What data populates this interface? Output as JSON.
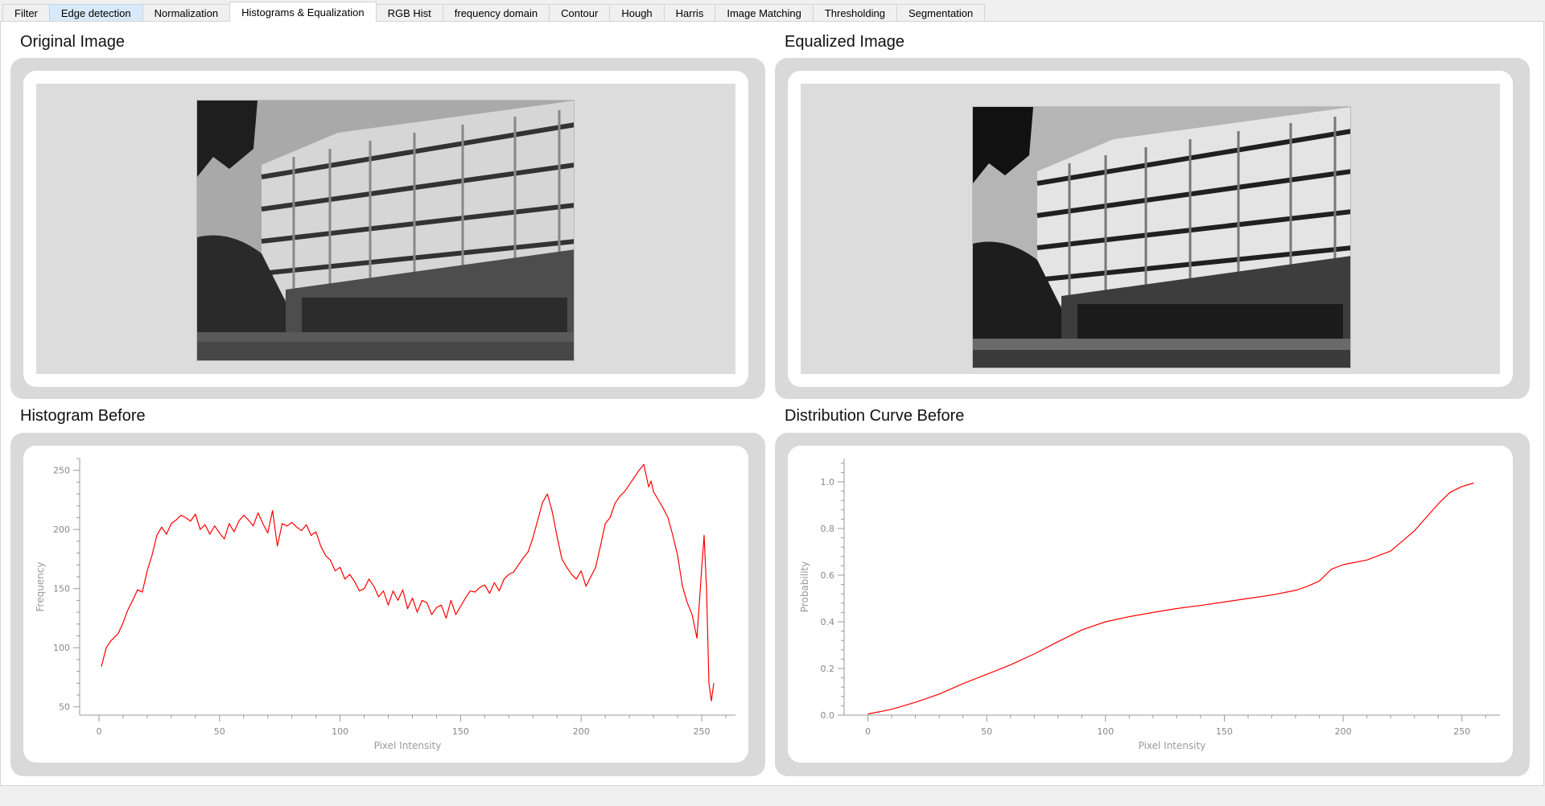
{
  "tabs": [
    {
      "label": "Filter",
      "state": "normal"
    },
    {
      "label": "Edge detection",
      "state": "hover"
    },
    {
      "label": "Normalization",
      "state": "normal"
    },
    {
      "label": "Histograms & Equalization",
      "state": "active"
    },
    {
      "label": "RGB Hist",
      "state": "normal"
    },
    {
      "label": "frequency domain",
      "state": "normal"
    },
    {
      "label": "Contour",
      "state": "normal"
    },
    {
      "label": "Hough",
      "state": "normal"
    },
    {
      "label": "Harris",
      "state": "normal"
    },
    {
      "label": "Image Matching",
      "state": "normal"
    },
    {
      "label": "Thresholding",
      "state": "normal"
    },
    {
      "label": "Segmentation",
      "state": "normal"
    }
  ],
  "panels": {
    "original_title": "Original Image",
    "equalized_title": "Equalized Image",
    "histogram_title": "Histogram Before",
    "distribution_title": "Distribution Curve Before"
  },
  "colors": {
    "curve": "#ff0000",
    "panel_bg": "#d9d9d9",
    "axis": "#999999"
  },
  "chart_data": [
    {
      "type": "line",
      "title": "",
      "xlabel": "Pixel Intensity",
      "ylabel": "Frequency",
      "xlim": [
        -8,
        264
      ],
      "ylim": [
        43,
        260
      ],
      "xticks": [
        0,
        50,
        100,
        150,
        200,
        250
      ],
      "yticks": [
        50,
        100,
        150,
        200,
        250
      ],
      "series": [
        {
          "x": [
            1,
            3,
            5,
            8,
            10,
            12,
            14,
            16,
            18,
            20,
            22,
            24,
            26,
            28,
            30,
            32,
            34,
            36,
            38,
            40,
            42,
            44,
            46,
            48,
            50,
            52,
            54,
            56,
            58,
            60,
            62,
            64,
            66,
            68,
            70,
            72,
            74,
            76,
            78,
            80,
            82,
            84,
            86,
            88,
            90,
            92,
            94,
            96,
            98,
            100,
            102,
            104,
            106,
            108,
            110,
            112,
            114,
            116,
            118,
            120,
            122,
            124,
            126,
            128,
            130,
            132,
            134,
            136,
            138,
            140,
            142,
            144,
            146,
            148,
            150,
            152,
            154,
            156,
            158,
            160,
            162,
            164,
            166,
            168,
            170,
            172,
            174,
            176,
            178,
            180,
            182,
            184,
            186,
            188,
            190,
            192,
            194,
            196,
            198,
            200,
            202,
            204,
            206,
            208,
            210,
            212,
            214,
            216,
            218,
            220,
            222,
            224,
            226,
            228,
            229,
            230,
            232,
            234,
            236,
            238,
            240,
            242,
            244,
            246,
            248,
            250,
            251,
            252,
            253,
            254,
            255
          ],
          "values": [
            84,
            100,
            106,
            112,
            121,
            132,
            140,
            149,
            147,
            165,
            178,
            195,
            202,
            196,
            205,
            208,
            212,
            210,
            207,
            213,
            200,
            204,
            196,
            203,
            197,
            192,
            205,
            198,
            207,
            212,
            208,
            203,
            214,
            205,
            197,
            216,
            186,
            205,
            203,
            206,
            202,
            199,
            204,
            195,
            198,
            186,
            178,
            174,
            165,
            168,
            158,
            162,
            156,
            148,
            150,
            158,
            152,
            143,
            148,
            136,
            148,
            140,
            149,
            133,
            142,
            130,
            140,
            138,
            128,
            134,
            136,
            125,
            140,
            128,
            135,
            142,
            148,
            147,
            151,
            153,
            146,
            155,
            148,
            158,
            162,
            164,
            170,
            176,
            181,
            193,
            208,
            223,
            230,
            215,
            194,
            175,
            168,
            162,
            158,
            165,
            152,
            160,
            168,
            186,
            205,
            210,
            222,
            228,
            232,
            238,
            244,
            250,
            255,
            236,
            241,
            232,
            225,
            218,
            210,
            195,
            178,
            152,
            138,
            128,
            108,
            168,
            195,
            150,
            70,
            55,
            70
          ]
        }
      ]
    },
    {
      "type": "line",
      "title": "",
      "xlabel": "Pixel Intensity",
      "ylabel": "Probability",
      "xlim": [
        -10,
        266
      ],
      "ylim": [
        0,
        1.1
      ],
      "xticks": [
        0,
        50,
        100,
        150,
        200,
        250
      ],
      "yticks": [
        0,
        0.2,
        0.4,
        0.6,
        0.8,
        1.0
      ],
      "series": [
        {
          "x": [
            0,
            10,
            20,
            30,
            40,
            50,
            60,
            70,
            80,
            90,
            100,
            110,
            120,
            130,
            140,
            150,
            160,
            170,
            180,
            185,
            190,
            195,
            200,
            210,
            220,
            230,
            240,
            245,
            250,
            255
          ],
          "values": [
            0.005,
            0.025,
            0.055,
            0.09,
            0.135,
            0.175,
            0.215,
            0.262,
            0.315,
            0.365,
            0.4,
            0.422,
            0.44,
            0.457,
            0.47,
            0.485,
            0.5,
            0.515,
            0.535,
            0.552,
            0.575,
            0.625,
            0.645,
            0.665,
            0.703,
            0.79,
            0.905,
            0.955,
            0.98,
            0.995
          ]
        }
      ]
    }
  ]
}
